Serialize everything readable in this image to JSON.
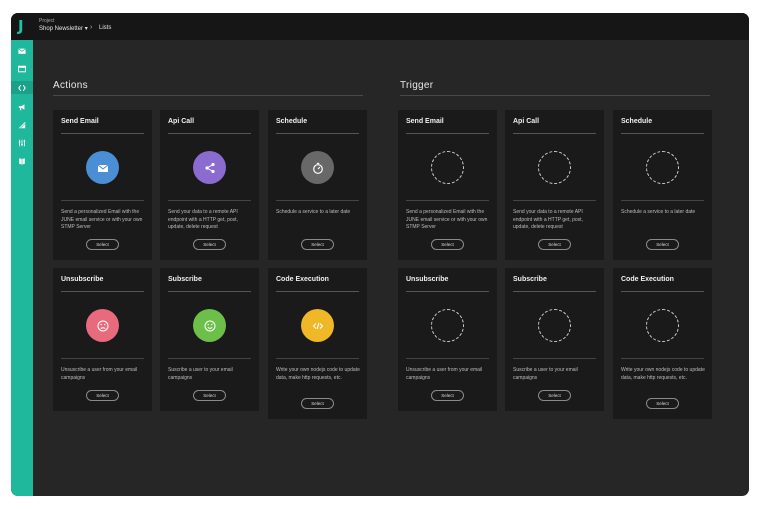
{
  "app": {
    "logo": "J"
  },
  "header": {
    "project_label": "Project",
    "project_name": "Shop Newsletter ▾",
    "separator": "›",
    "current": "Lists"
  },
  "sidebar": {
    "items": [
      {
        "icon": "mail-icon"
      },
      {
        "icon": "window-icon"
      },
      {
        "icon": "code-icon"
      },
      {
        "icon": "megaphone-icon"
      },
      {
        "icon": "signal-icon"
      },
      {
        "icon": "sliders-icon"
      },
      {
        "icon": "book-icon"
      }
    ]
  },
  "colors": {
    "accent": "#1fb89c",
    "blue": "#4a8fd6",
    "purple": "#8c6bd1",
    "gray": "#686868",
    "red": "#e86b7d",
    "green": "#6cc04a",
    "yellow": "#f0b726"
  },
  "actions": {
    "title": "Actions",
    "cards": [
      {
        "title": "Send Email",
        "icon": "envelope-icon",
        "desc": "Send a personalized Email with the JUNE email service or with your own STMP Server",
        "button": "Select"
      },
      {
        "title": "Api Call",
        "icon": "share-icon",
        "desc": "Send your data to a remote API endpoint with a HTTP get, post, update, delete request",
        "button": "Select"
      },
      {
        "title": "Schedule",
        "icon": "stopwatch-icon",
        "desc": "Schedule a service to a later date",
        "button": "Select"
      },
      {
        "title": "Unsubscribe",
        "icon": "sad-face-icon",
        "desc": "Unsuscribe a user from your email campaigns",
        "button": "Select"
      },
      {
        "title": "Subscribe",
        "icon": "smile-face-icon",
        "desc": "Suscribe a user to your email campaigns",
        "button": "Select"
      },
      {
        "title": "Code Execution",
        "icon": "code-icon",
        "desc": "Write your own nodejs code to update data, make http requests, etc.",
        "button": "Select"
      }
    ]
  },
  "trigger": {
    "title": "Trigger",
    "cards": [
      {
        "title": "Send Email",
        "desc": "Send a personalized Email with the JUNE email service or with your own STMP Server",
        "button": "Select"
      },
      {
        "title": "Api Call",
        "desc": "Send your data to a remote API endpoint with a HTTP get, post, update, delete request",
        "button": "Select"
      },
      {
        "title": "Schedule",
        "desc": "Schedule a service to a later date",
        "button": "Select"
      },
      {
        "title": "Unsubscribe",
        "desc": "Unsuscribe a user from your email campaigns",
        "button": "Select"
      },
      {
        "title": "Subscribe",
        "desc": "Suscribe a user to your email campaigns",
        "button": "Select"
      },
      {
        "title": "Code Execution",
        "desc": "Write your own nodejs code to update data, make http requests, etc.",
        "button": "Select"
      }
    ]
  }
}
